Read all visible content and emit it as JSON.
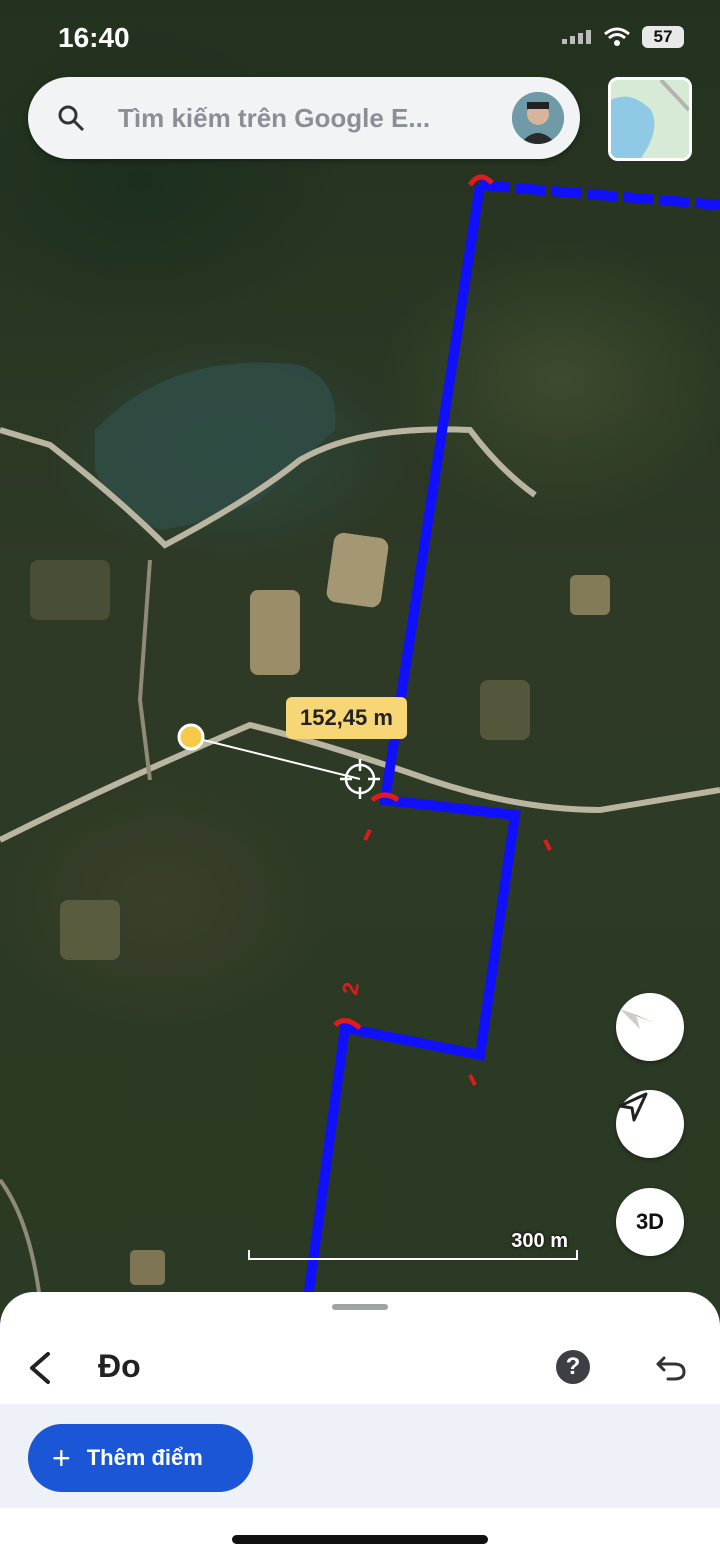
{
  "status_bar": {
    "time": "16:40",
    "battery": "57"
  },
  "search": {
    "placeholder": "Tìm kiếm trên Google E..."
  },
  "map": {
    "measurement_label": "152,45 m",
    "scale_label": "300 m",
    "compass_icon": "compass-icon",
    "location_icon": "navigation-arrow-icon",
    "btn_3d": "3D",
    "path_color": "#1010ff",
    "marker_color": "#e01b1b",
    "marker_labels": [
      "2"
    ]
  },
  "sheet": {
    "title": "Đo",
    "help_icon": "help-icon",
    "undo_icon": "undo-icon",
    "add_point_label": "Thêm điểm"
  },
  "colors": {
    "accent": "#1a56d6",
    "label_bg": "#f7d676"
  }
}
